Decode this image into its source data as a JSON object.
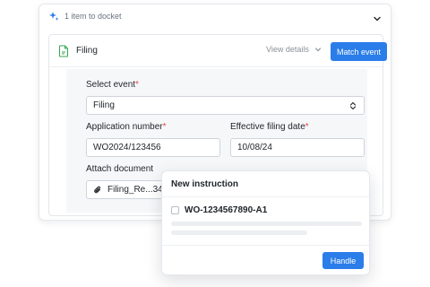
{
  "docket": {
    "title": "1 item to docket",
    "accent_color": "#2b7de9"
  },
  "filing": {
    "name": "Filing",
    "view_details_label": "View details",
    "match_button_label": "Match event"
  },
  "form": {
    "select_event": {
      "label": "Select event",
      "required": "*",
      "value": "Filing"
    },
    "application_number": {
      "label": "Application number",
      "required": "*",
      "value": "WO2024/123456"
    },
    "effective_filing_date": {
      "label": "Effective filing date",
      "required": "*",
      "value": "10/08/24"
    },
    "attach_document": {
      "label": "Attach document",
      "value": "Filing_Re...3456.p"
    }
  },
  "overlay": {
    "title": "New instruction",
    "instruction_id": "WO-1234567890-A1",
    "handle_button_label": "Handle"
  },
  "icons": {
    "header": "sparkle-icon",
    "collapse": "chevron-down-icon",
    "filing": "file-icon",
    "view_details": "chevron-down-icon",
    "select": "select-arrows-icon",
    "attach": "paperclip-icon"
  }
}
